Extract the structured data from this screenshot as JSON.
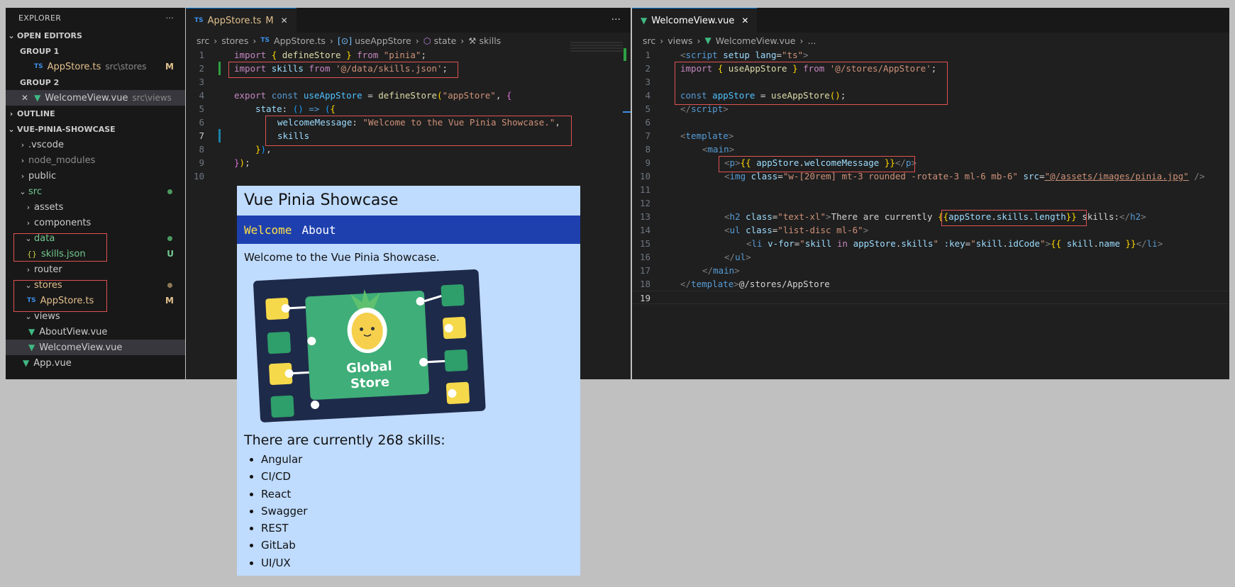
{
  "explorer": {
    "title": "EXPLORER",
    "more": "···",
    "open_editors": "OPEN EDITORS",
    "group1": "GROUP 1",
    "group1_file": "AppStore.ts",
    "group1_desc": "src\\stores",
    "group1_badge": "M",
    "group2": "GROUP 2",
    "group2_file": "WelcomeView.vue",
    "group2_desc": "src\\views",
    "outline": "OUTLINE",
    "project": "VUE-PINIA-SHOWCASE",
    "tree": {
      "vscode": ".vscode",
      "node_modules": "node_modules",
      "public": "public",
      "src": "src",
      "assets": "assets",
      "components": "components",
      "data": "data",
      "skills_json": "skills.json",
      "skills_badge": "U",
      "router": "router",
      "stores": "stores",
      "appstore": "AppStore.ts",
      "appstore_badge": "M",
      "views": "views",
      "aboutview": "AboutView.vue",
      "welcomeview": "WelcomeView.vue",
      "app": "App.vue"
    }
  },
  "pane1": {
    "tab": "AppStore.ts",
    "tab_badge": "M",
    "crumbs": [
      "src",
      "stores",
      "AppStore.ts",
      "useAppStore",
      "state",
      "skills"
    ],
    "lines": [
      "1",
      "2",
      "3",
      "4",
      "5",
      "6",
      "7",
      "8",
      "9",
      "10"
    ]
  },
  "pane2": {
    "tab": "WelcomeView.vue",
    "crumbs": [
      "src",
      "views",
      "WelcomeView.vue",
      "..."
    ],
    "lines": [
      "1",
      "2",
      "3",
      "4",
      "5",
      "6",
      "7",
      "8",
      "9",
      "10",
      "11",
      "12",
      "13",
      "14",
      "15",
      "16",
      "17",
      "18",
      "19"
    ]
  },
  "preview": {
    "title": "Vue Pinia Showcase",
    "nav": [
      "Welcome",
      "About"
    ],
    "welcome": "Welcome to the Vue Pinia Showcase.",
    "image_text_1": "Global",
    "image_text_2": "Store",
    "heading": "There are currently 268 skills:",
    "skills": [
      "Angular",
      "CI/CD",
      "React",
      "Swagger",
      "REST",
      "GitLab",
      "UI/UX"
    ]
  },
  "colors": {
    "preview_bg": "#bfdbfe",
    "nav_bg": "#1e40af",
    "active_link": "#fde047",
    "highlight_box": "#e05252"
  }
}
